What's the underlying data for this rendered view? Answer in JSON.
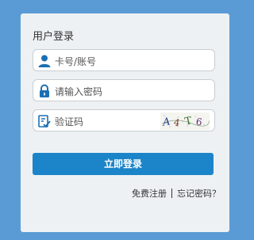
{
  "login": {
    "title": "用户登录",
    "username_placeholder": "卡号/账号",
    "password_placeholder": "请输入密码",
    "captcha_placeholder": "验证码",
    "submit_label": "立即登录",
    "register_link": "免费注册",
    "forgot_link": "忘记密码？"
  },
  "captcha_image": {
    "text": "A4T6"
  },
  "colors": {
    "page_bg": "#5b9bd5",
    "panel_bg": "#eef1f3",
    "button_bg": "#1c85c9",
    "icon": "#1c6fb3"
  },
  "icons": {
    "username": "user-icon",
    "password": "lock-icon",
    "captcha": "edit-check-icon"
  }
}
